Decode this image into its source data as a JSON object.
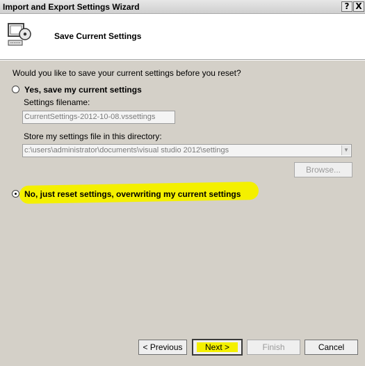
{
  "window": {
    "title": "Import and Export Settings Wizard",
    "help_glyph": "?",
    "close_glyph": "X"
  },
  "header": {
    "title": "Save Current Settings",
    "icon": "settings-computer-disc-icon"
  },
  "form": {
    "question": "Would you like to save your current settings before you reset?",
    "option_yes_label": "Yes, save my current settings",
    "filename_label": "Settings filename:",
    "filename_value": "CurrentSettings-2012-10-08.vssettings",
    "directory_label": "Store my settings file in this directory:",
    "directory_value": "c:\\users\\administrator\\documents\\visual studio 2012\\settings",
    "browse_label": "Browse...",
    "option_no_label": "No, just reset settings, overwriting my current settings",
    "selected_option": "no"
  },
  "footer": {
    "previous_label": "< Previous",
    "next_label": "Next >",
    "finish_label": "Finish",
    "cancel_label": "Cancel"
  },
  "colors": {
    "highlight": "#f4f000",
    "dialog_bg": "#d4d0c8"
  }
}
